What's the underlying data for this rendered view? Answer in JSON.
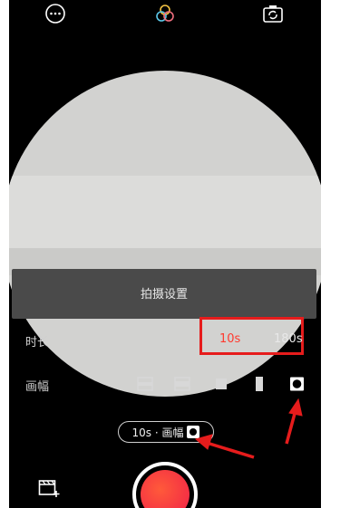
{
  "top_bar": {
    "icons": [
      "more-icon",
      "filter-icon",
      "switch-camera-icon"
    ]
  },
  "panel": {
    "title": "拍摄设置"
  },
  "duration": {
    "label": "时长",
    "options": [
      "10s",
      "180s"
    ],
    "selected": "10s"
  },
  "frame": {
    "label": "画幅",
    "selected_index": 4
  },
  "status_pill": {
    "text": "10s · 画幅"
  },
  "colors": {
    "accent": "#ff3a2f",
    "highlight": "#e61c1c",
    "panel": "#4a4a4a"
  }
}
